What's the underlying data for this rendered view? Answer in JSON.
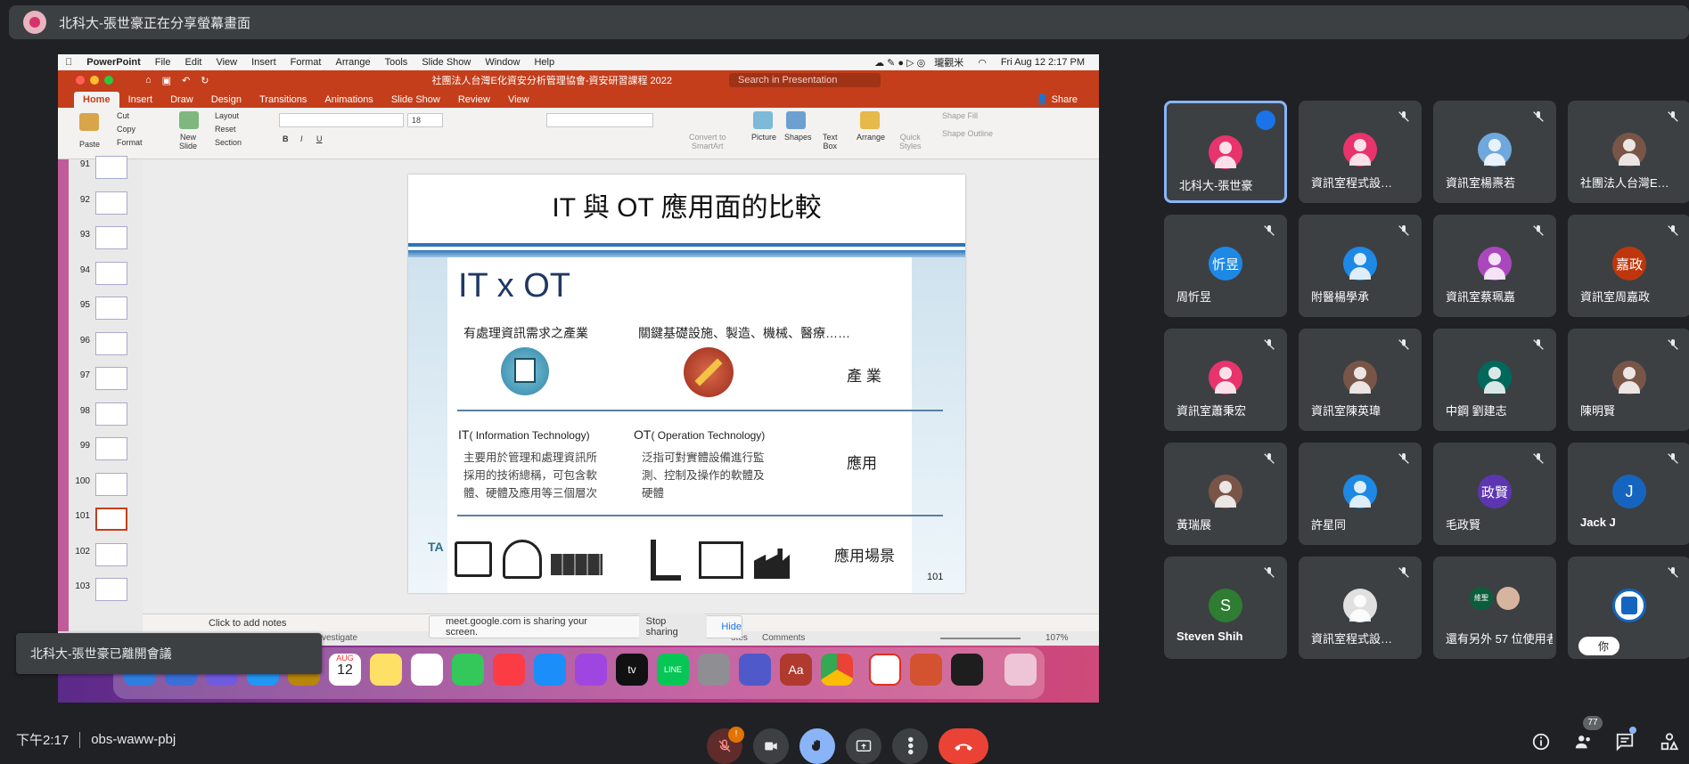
{
  "banner": {
    "text": "北科大-張世豪正在分享螢幕畫面"
  },
  "mac_menubar": {
    "app": "PowerPoint",
    "menus": [
      "File",
      "Edit",
      "View",
      "Insert",
      "Format",
      "Arrange",
      "Tools",
      "Slide Show",
      "Window",
      "Help"
    ],
    "user_label": "瓏觀米",
    "clock": "Fri Aug 12  2:17 PM"
  },
  "ppt": {
    "doc_title": "社團法人台灣E化資安分析管理協會-資安研習課程 2022",
    "search_placeholder": "Search in Presentation",
    "tabs": [
      "Home",
      "Insert",
      "Draw",
      "Design",
      "Transitions",
      "Animations",
      "Slide Show",
      "Review",
      "View"
    ],
    "share_label": "Share",
    "ribbon": {
      "paste": "Paste",
      "cut": "Cut",
      "copy": "Copy",
      "format": "Format",
      "new_slide": "New\nSlide",
      "layout": "Layout",
      "reset": "Reset",
      "section": "Section",
      "font_size": "18",
      "convert": "Convert to\nSmartArt",
      "picture": "Picture",
      "shapes": "Shapes",
      "textbox": "Text\nBox",
      "arrange": "Arrange",
      "quick_styles": "Quick\nStyles",
      "shape_fill": "Shape Fill",
      "shape_outline": "Shape Outline"
    },
    "thumbnails": [
      "91",
      "92",
      "93",
      "94",
      "95",
      "96",
      "97",
      "98",
      "99",
      "100",
      "101",
      "102",
      "103"
    ],
    "selected_thumbnail": "101",
    "notes_placeholder": "Click to add notes",
    "status": {
      "investigate": "vestigate",
      "notes": "otes",
      "comments": "Comments",
      "zoom": "107%"
    }
  },
  "slide": {
    "title": "IT 與 OT 應用面的比較",
    "heading": "IT x OT",
    "it_industry": "有處理資訊需求之產業",
    "ot_industry": "關鍵基礎設施、製造、機械、醫療……",
    "label_industry": "產 業",
    "it_name_main": "IT",
    "it_name_sub": "( Information Technology)",
    "ot_name_main": "OT",
    "ot_name_sub": "( Operation Technology)",
    "it_desc": [
      "主要用於管理和處理資訊所",
      "採用的技術總稱，可包含軟",
      "體、硬體及應用等三個層次"
    ],
    "ot_desc": [
      "泛指可對實體設備進行監",
      "測、控制及操作的軟體及",
      "硬體"
    ],
    "label_application": "應用",
    "label_scenario": "應用場景",
    "logo_text": "TA",
    "page_number": "101"
  },
  "share_pill": {
    "text": "meet.google.com is sharing your screen.",
    "stop": "Stop sharing",
    "hide": "Hide"
  },
  "dock": {
    "calendar_month": "AUG",
    "calendar_day": "12",
    "appletv": "tv",
    "line": "LINE",
    "dictionary": "Aa"
  },
  "left_toast": {
    "text": "北科大-張世豪已離開會議"
  },
  "participants": [
    {
      "name": "北科大-張世豪",
      "color": "#e8336d",
      "initial": "",
      "muted": false
    },
    {
      "name": "資訊室程式設…",
      "color": "#e8336d",
      "initial": "",
      "muted": true
    },
    {
      "name": "資訊室楊燾若",
      "color": "#6fa8dc",
      "initial": "",
      "muted": true
    },
    {
      "name": "社團法人台灣E…",
      "color": "#795548",
      "initial": "",
      "muted": true
    },
    {
      "name": "周忻昱",
      "color": "#1e88e5",
      "initial": "忻昱",
      "muted": true
    },
    {
      "name": "附醫楊學承",
      "color": "#1e88e5",
      "initial": "",
      "muted": true
    },
    {
      "name": "資訊室蔡珮嘉",
      "color": "#ab47bc",
      "initial": "",
      "muted": true
    },
    {
      "name": "資訊室周嘉政",
      "color": "#bf360c",
      "initial": "嘉政",
      "muted": true
    },
    {
      "name": "資訊室蕭秉宏",
      "color": "#e8336d",
      "initial": "",
      "muted": true
    },
    {
      "name": "資訊室陳英瑋",
      "color": "#795548",
      "initial": "",
      "muted": true
    },
    {
      "name": "中鋼 劉建志",
      "color": "#00695c",
      "initial": "",
      "muted": true
    },
    {
      "name": "陳明賢",
      "color": "#795548",
      "initial": "",
      "muted": true
    },
    {
      "name": "黃瑞展",
      "color": "#795548",
      "initial": "",
      "muted": true
    },
    {
      "name": "許星同",
      "color": "#1e88e5",
      "initial": "",
      "muted": true
    },
    {
      "name": "毛政賢",
      "color": "#5e35b1",
      "initial": "政賢",
      "muted": true
    },
    {
      "name": "Jack J",
      "color": "#1565c0",
      "initial": "J",
      "muted": true
    },
    {
      "name": "Steven Shih",
      "color": "#2e7d32",
      "initial": "S",
      "muted": true
    },
    {
      "name": "資訊室程式設…",
      "color": "#e0e0e0",
      "initial": "",
      "muted": true
    },
    {
      "name": "還有另外 57 位使用者",
      "color": "#3c4043",
      "initial": "",
      "muted": false
    },
    {
      "name": "你",
      "color": "#ffffff",
      "initial": "",
      "muted": true
    }
  ],
  "others_avatar_labels": [
    "維聖",
    ""
  ],
  "bottom": {
    "time": "下午2:17",
    "meeting_code": "obs-waww-pbj",
    "mic_badge": "!",
    "people_count": "77"
  }
}
